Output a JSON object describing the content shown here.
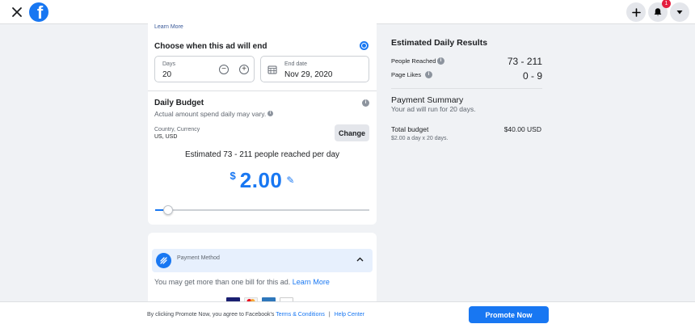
{
  "topbar": {
    "close_icon": "close-icon",
    "logo_letter": "f",
    "add_icon": "plus-icon",
    "notifications_icon": "bell-icon",
    "notifications_count": "1",
    "menu_icon": "caret-down-icon"
  },
  "ad_duration": {
    "learn_more": "Learn More",
    "title": "Choose when this ad will end",
    "days_label": "Days",
    "days_value": "20",
    "end_date_label": "End date",
    "end_date_value": "Nov 29, 2020"
  },
  "daily_budget": {
    "title": "Daily Budget",
    "subtitle": "Actual amount spend daily may vary.",
    "country_currency_label": "Country, Currency",
    "country_currency_value": "US, USD",
    "change_label": "Change",
    "estimate_text": "Estimated 73 - 211 people reached per day",
    "currency_symbol": "$",
    "amount": "2.00",
    "slider_fraction": 0.06
  },
  "payment": {
    "method_label": "Payment Method",
    "bill_note": "You may get more than one bill for this ad.",
    "bill_learn_more": "Learn More",
    "card_icons": [
      "visa-icon",
      "mastercard-icon",
      "amex-icon",
      "discover-icon"
    ]
  },
  "results": {
    "title": "Estimated Daily Results",
    "people_reached_label": "People Reached",
    "people_reached_value": "73 - 211",
    "page_likes_label": "Page Likes",
    "page_likes_value": "0 - 9"
  },
  "summary": {
    "title": "Payment Summary",
    "duration_text": "Your ad will run for 20 days.",
    "total_label": "Total budget",
    "total_value": "$40.00 USD",
    "total_detail": "$2.00 a day x 20 days."
  },
  "footer": {
    "agreement_text": "By clicking Promote Now, you agree to Facebook's",
    "terms_link": "Terms & Conditions",
    "separator": "|",
    "help_link": "Help Center",
    "promote_label": "Promote Now"
  },
  "colors": {
    "accent": "#1877f2",
    "badge": "#e41e3f"
  }
}
